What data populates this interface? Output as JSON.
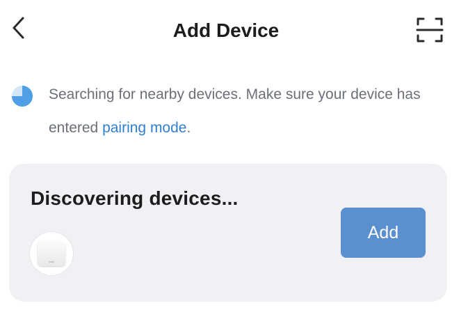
{
  "header": {
    "title": "Add Device",
    "back_icon": "chevron-left-icon",
    "scan_icon": "scan-icon"
  },
  "status": {
    "icon": "loading-spinner-icon",
    "message_prefix": "Searching for nearby devices. Make sure your device has entered ",
    "link_text": "pairing mode",
    "message_suffix": "."
  },
  "discovery": {
    "title": "Discovering devices...",
    "device_icon": "device-thumbnail",
    "add_label": "Add"
  },
  "colors": {
    "link": "#2f7fd1",
    "spinner": "#4f9ee6",
    "button": "#5a8fd0",
    "card_bg": "#f0f0f5",
    "text_primary": "#1c1c1c",
    "text_secondary": "#6b6f78"
  }
}
